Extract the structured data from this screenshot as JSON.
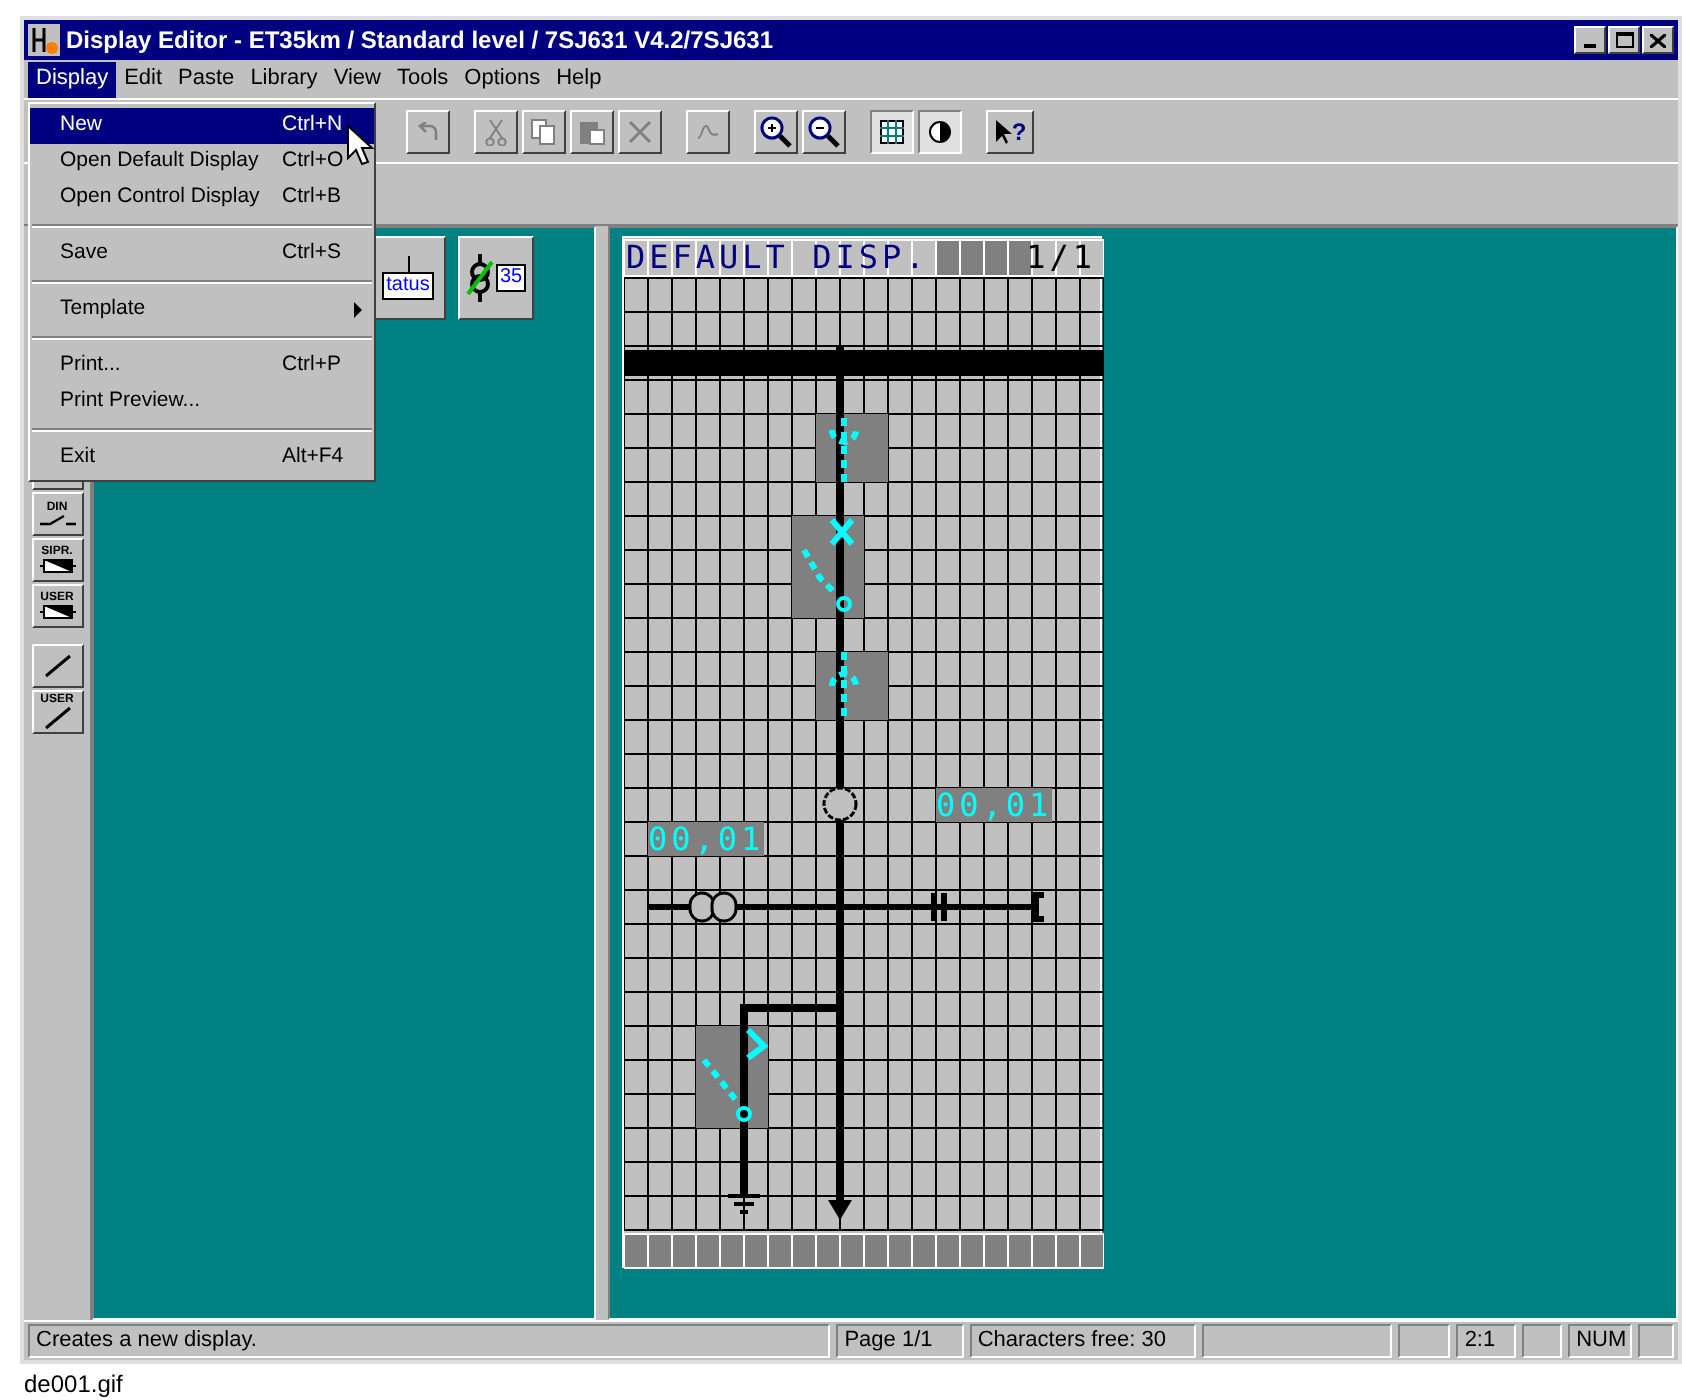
{
  "window": {
    "title": "Display Editor - ET35km / Standard level / 7SJ631 V4.2/7SJ631"
  },
  "menu_bar": [
    {
      "label": "Display",
      "selected": true
    },
    {
      "label": "Edit",
      "selected": false
    },
    {
      "label": "Paste",
      "selected": false
    },
    {
      "label": "Library",
      "selected": false
    },
    {
      "label": "View",
      "selected": false
    },
    {
      "label": "Tools",
      "selected": false
    },
    {
      "label": "Options",
      "selected": false
    },
    {
      "label": "Help",
      "selected": false
    }
  ],
  "toolbar": {
    "grid_pressed": true,
    "contrast_pressed": true,
    "help_symbol": "?"
  },
  "display_menu": [
    {
      "kind": "item",
      "label": "New",
      "shortcut": "Ctrl+N",
      "selected": true
    },
    {
      "kind": "item",
      "label": "Open Default Display",
      "shortcut": "Ctrl+O",
      "selected": false
    },
    {
      "kind": "item",
      "label": "Open Control Display",
      "shortcut": "Ctrl+B",
      "selected": false
    },
    {
      "kind": "separator"
    },
    {
      "kind": "item",
      "label": "Save",
      "shortcut": "Ctrl+S",
      "selected": false
    },
    {
      "kind": "separator"
    },
    {
      "kind": "submenu",
      "label": "Template",
      "selected": false
    },
    {
      "kind": "separator"
    },
    {
      "kind": "item",
      "label": "Print...",
      "shortcut": "Ctrl+P",
      "selected": false
    },
    {
      "kind": "item",
      "label": "Print Preview...",
      "selected": false
    },
    {
      "kind": "separator"
    },
    {
      "kind": "item",
      "label": "Exit",
      "shortcut": "Alt+F4",
      "selected": false
    }
  ],
  "palette": [
    {
      "kind": "frame"
    },
    {
      "kind": "switch",
      "label": "DIN"
    },
    {
      "kind": "block",
      "label": "SIPR."
    },
    {
      "kind": "block",
      "label": "USER"
    },
    {
      "kind": "gap"
    },
    {
      "kind": "line"
    },
    {
      "kind": "line",
      "label": "USER"
    }
  ],
  "library": [
    {
      "kind": "status",
      "label": "tatus"
    },
    {
      "kind": "measure",
      "label": "35"
    }
  ],
  "display": {
    "title": "DEFAULT DISP.",
    "page": "1/1",
    "values": [
      "00,01",
      "00,01"
    ]
  },
  "status_bar": [
    {
      "kind": "text",
      "text": "Creates a new display."
    },
    {
      "kind": "text",
      "text": "Page 1/1"
    },
    {
      "kind": "text",
      "text": "Characters free: 30"
    },
    {
      "kind": "empty"
    },
    {
      "kind": "empty"
    },
    {
      "kind": "text",
      "text": "2:1"
    },
    {
      "kind": "empty"
    },
    {
      "kind": "text",
      "text": "NUM"
    },
    {
      "kind": "empty"
    }
  ],
  "caption": "de001.gif"
}
